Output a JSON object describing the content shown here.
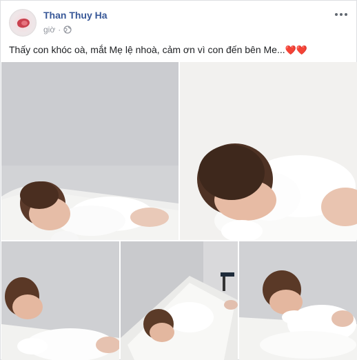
{
  "post": {
    "author": "Than Thuy Ha",
    "time": "giờ",
    "separator": "·",
    "privacy_icon": "globe-icon",
    "more_icon": "more-options-icon",
    "text": "Thấy con khóc oà, mắt Mẹ lệ nhoà, cảm ơn vì con đến bên Me...",
    "hearts": "❤️❤️"
  },
  "photos": [
    {
      "subject": "baby-photo-1"
    },
    {
      "subject": "baby-photo-2"
    },
    {
      "subject": "baby-photo-3"
    },
    {
      "subject": "baby-photo-4"
    },
    {
      "subject": "baby-photo-5"
    }
  ],
  "colors": {
    "author_link": "#385898",
    "meta_text": "#90949c",
    "heart": "#e0245e",
    "border": "#dddfe2"
  }
}
